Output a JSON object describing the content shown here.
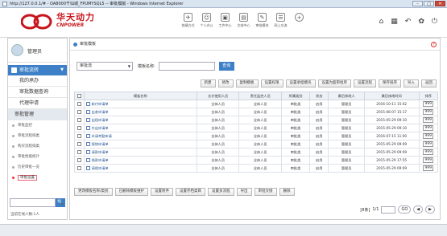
{
  "window": {
    "title": "http://127.0.0.1/# - OA8000千仙城_FPUMYSQL5 -- 审批模版 - Windows Internet Explorer",
    "min": "–",
    "max": "□",
    "close": "✕"
  },
  "brand": {
    "cn": "华天动力",
    "en": "CNPOWER",
    "logo_color": "#c8141c"
  },
  "topnav": [
    {
      "label": "快捷方式",
      "icon": "paper-plane-icon",
      "glyph": "✈"
    },
    {
      "label": "个人办公",
      "icon": "person-icon",
      "glyph": "☺"
    },
    {
      "label": "工作中心",
      "icon": "briefcase-icon",
      "glyph": "▣"
    },
    {
      "label": "文档中心",
      "icon": "document-icon",
      "glyph": "▤"
    },
    {
      "label": "审批模块",
      "icon": "approval-icon",
      "glyph": "✎"
    },
    {
      "label": "网上交流",
      "icon": "chat-icon",
      "glyph": "☰"
    },
    {
      "label": "",
      "icon": "plus-icon",
      "glyph": "+"
    }
  ],
  "righticons": [
    {
      "icon": "home-icon",
      "glyph": "⌂"
    },
    {
      "icon": "grid-icon",
      "glyph": "▦"
    },
    {
      "icon": "back-icon",
      "glyph": "↶"
    },
    {
      "icon": "settings-icon",
      "glyph": "✿"
    },
    {
      "icon": "power-icon",
      "glyph": "⏻"
    }
  ],
  "sidebar": {
    "user": "管理员",
    "section": "审批流转",
    "items": [
      "我的承办",
      "审批数据查询",
      "代理申请"
    ],
    "group": "审批管理",
    "subitems": [
      {
        "label": "审批监控"
      },
      {
        "label": "审批流程排类"
      },
      {
        "label": "购买流程排类"
      },
      {
        "label": "审批性能统计"
      },
      {
        "label": "历史审批一览"
      },
      {
        "label": "审批设置",
        "active": true
      }
    ],
    "search_glyph": "🔍",
    "online_text": "当前在线人数:1人"
  },
  "breadcrumb": "审批模板",
  "help": "?",
  "filter": {
    "select_value": "审批流",
    "label": "模板名称:",
    "input_value": "",
    "button": "查询"
  },
  "toolbar": [
    "新建",
    "修改",
    "复制模板",
    "设置权限",
    "设置承担模块",
    "设置为超审批单",
    "设置流程",
    "保存排序",
    "导入",
    "返回"
  ],
  "table": {
    "columns": [
      "",
      "模板名称",
      "允许使用人员",
      "责任监控人员",
      "所属类别",
      "状态",
      "最后修改人",
      "最后修改时间",
      "排序"
    ],
    "rows": [
      {
        "name": "新付申请单",
        "users": "全体人员",
        "monitors": "全体人员",
        "category": "审批类",
        "status": "启用",
        "modifier": "管理员",
        "time": "2016-10-11 15:02",
        "sort": "999"
      },
      {
        "name": "出差申请单",
        "users": "全体人员",
        "monitors": "全体人员",
        "category": "审批类",
        "status": "启用",
        "modifier": "管理员",
        "time": "2015-06-07 15:17",
        "sort": "999"
      },
      {
        "name": "出租申请单",
        "users": "全体人员",
        "monitors": "全体人员",
        "category": "审批类",
        "status": "启用",
        "modifier": "管理员",
        "time": "2015-05-29 09:10",
        "sort": "999"
      },
      {
        "name": "外出申请单",
        "users": "全体人员",
        "monitors": "全体人员",
        "category": "审批类",
        "status": "启用",
        "modifier": "管理员",
        "time": "2015-05-29 09:10",
        "sort": "999"
      },
      {
        "name": "补请考勤申请",
        "users": "全体人员",
        "monitors": "全体人员",
        "category": "审批类",
        "status": "启用",
        "modifier": "管理员",
        "time": "2016-07-15 11:00",
        "sort": "999"
      },
      {
        "name": "报销申请单",
        "users": "全体人员",
        "monitors": "全体人员",
        "category": "审批类",
        "status": "启用",
        "modifier": "管理员",
        "time": "2015-05-29 09:09",
        "sort": "999"
      },
      {
        "name": "请款申请单",
        "users": "全体人员",
        "monitors": "全体人员",
        "category": "审批类",
        "status": "启用",
        "modifier": "管理员",
        "time": "2015-05-29 09:09",
        "sort": "999"
      },
      {
        "name": "借款申请单",
        "users": "全体人员",
        "monitors": "全体人员",
        "category": "审批类",
        "status": "启用",
        "modifier": "管理员",
        "time": "2015-05-29 17:55",
        "sort": "999"
      },
      {
        "name": "请假申请单",
        "users": "全体人员",
        "monitors": "全体人员",
        "category": "审批类",
        "status": "启用",
        "modifier": "管理员",
        "time": "2015-05-29 09:09",
        "sort": "999"
      }
    ]
  },
  "bottombar": [
    "更改模板名称/类别",
    "已删除模板维护",
    "设置附件",
    "设置存档类目",
    "设置多流程",
    "导出",
    "审批文接",
    "删除"
  ],
  "pager": {
    "total": "[8条]",
    "page": "1/1",
    "go": "GO",
    "prev": "◀",
    "next": "▶"
  },
  "colors": {
    "accent": "#3d80c8",
    "brand": "#c8141c"
  }
}
